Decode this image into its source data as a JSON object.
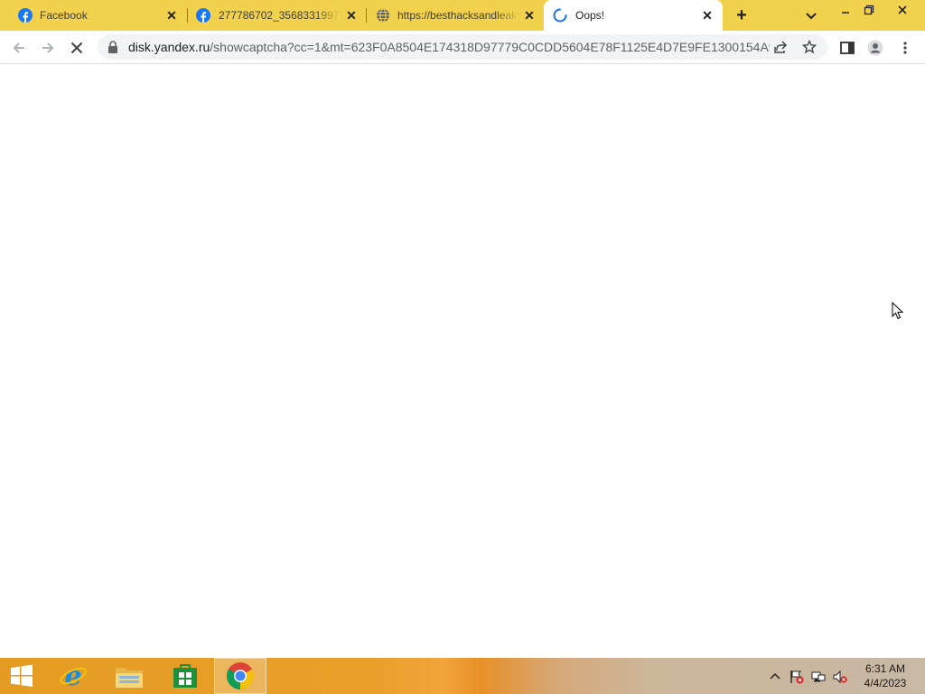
{
  "browser": {
    "tabs": [
      {
        "title": "Facebook",
        "favicon": "facebook-icon",
        "active": false
      },
      {
        "title": "277786702_356833199789",
        "favicon": "facebook-icon",
        "active": false
      },
      {
        "title": "https://besthacksandleaks",
        "favicon": "globe-icon",
        "active": false
      },
      {
        "title": "Oops!",
        "favicon": "loading-spinner-icon",
        "active": true
      }
    ],
    "new_tab_label": "+",
    "url_host": "disk.yandex.ru",
    "url_path": "/showcaptcha?cc=1&mt=623F0A8504E174318D97779C0CDD5604E78F1125E4D7E9FE1300154A91...",
    "frame_color": "#f2d24d"
  },
  "taskbar": {
    "apps": [
      {
        "name": "start-button",
        "icon": "windows-logo-icon"
      },
      {
        "name": "internet-explorer",
        "icon": "internet-explorer-icon"
      },
      {
        "name": "file-explorer",
        "icon": "folder-icon"
      },
      {
        "name": "store",
        "icon": "store-icon"
      },
      {
        "name": "chrome",
        "icon": "chrome-icon",
        "active": true
      }
    ],
    "time": "6:31 AM",
    "date": "4/4/2023"
  }
}
